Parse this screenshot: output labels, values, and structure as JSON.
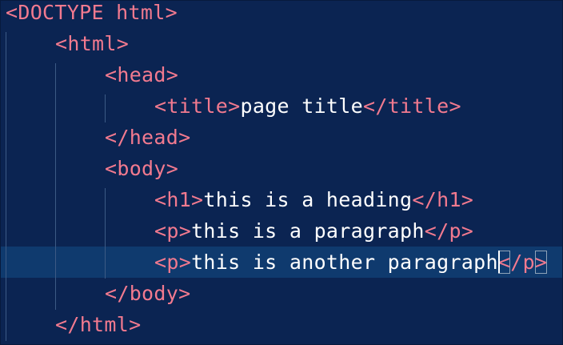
{
  "editor": {
    "lines": [
      {
        "indent": 0,
        "parts": [
          {
            "t": "tag",
            "v": "<DOCTYPE html>"
          }
        ]
      },
      {
        "indent": 1,
        "parts": [
          {
            "t": "tag",
            "v": "<html>"
          }
        ]
      },
      {
        "indent": 2,
        "parts": [
          {
            "t": "tag",
            "v": "<head>"
          }
        ]
      },
      {
        "indent": 3,
        "parts": [
          {
            "t": "tag",
            "v": "<title>"
          },
          {
            "t": "txt",
            "v": "page title"
          },
          {
            "t": "tag",
            "v": "</title>"
          }
        ]
      },
      {
        "indent": 2,
        "parts": [
          {
            "t": "tag",
            "v": "</head>"
          }
        ]
      },
      {
        "indent": 2,
        "parts": [
          {
            "t": "tag",
            "v": "<body>"
          }
        ]
      },
      {
        "indent": 3,
        "parts": [
          {
            "t": "tag",
            "v": "<h1>"
          },
          {
            "t": "txt",
            "v": "this is a heading"
          },
          {
            "t": "tag",
            "v": "</h1>"
          }
        ]
      },
      {
        "indent": 3,
        "parts": [
          {
            "t": "tag",
            "v": "<p>"
          },
          {
            "t": "txt",
            "v": "this is a paragraph"
          },
          {
            "t": "tag",
            "v": "</p>"
          }
        ]
      },
      {
        "indent": 3,
        "active": true,
        "parts": [
          {
            "t": "tag",
            "v": "<p>"
          },
          {
            "t": "txt",
            "v": "this is another paragraph"
          },
          {
            "t": "caret",
            "v": ""
          },
          {
            "t": "tag-box",
            "v": "<"
          },
          {
            "t": "tag",
            "v": "/p"
          },
          {
            "t": "tag-box",
            "v": ">"
          }
        ]
      },
      {
        "indent": 2,
        "parts": [
          {
            "t": "tag",
            "v": "</body>"
          }
        ]
      },
      {
        "indent": 1,
        "parts": [
          {
            "t": "tag",
            "v": "</html>"
          }
        ]
      }
    ]
  },
  "colors": {
    "background": "#0b2452",
    "active_line": "#0f3a6e",
    "tag": "#f27a8f",
    "text": "#ffffff",
    "indent_guide": "#3c5a85"
  }
}
